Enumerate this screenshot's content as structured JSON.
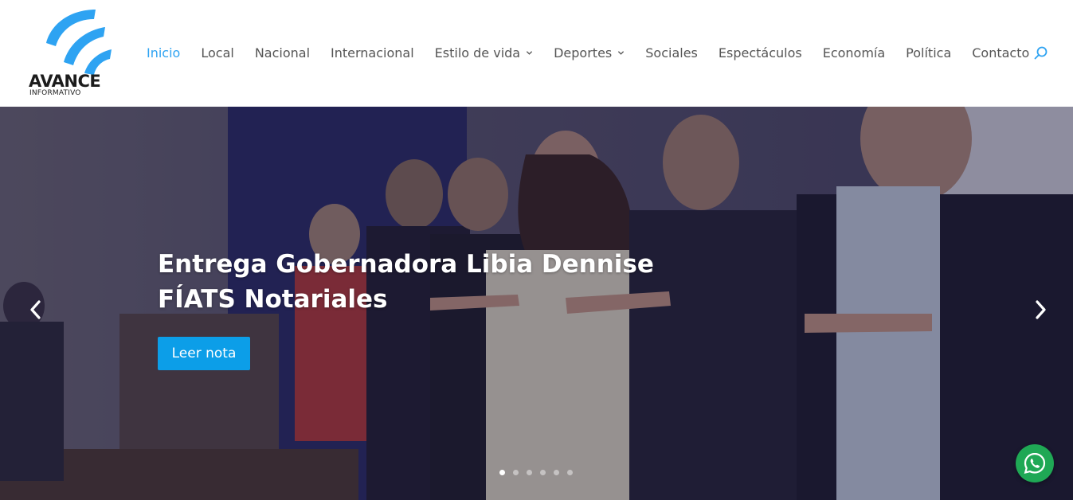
{
  "logo": {
    "title": "AVANCE",
    "subtitle": "INFORMATIVO"
  },
  "colors": {
    "accent": "#2ea3f2",
    "button": "#0c9ee8",
    "whatsapp": "#1fa855",
    "nav_text": "#555555"
  },
  "nav": {
    "items": [
      {
        "label": "Inicio",
        "active": true,
        "has_dropdown": false
      },
      {
        "label": "Local",
        "active": false,
        "has_dropdown": false
      },
      {
        "label": "Nacional",
        "active": false,
        "has_dropdown": false
      },
      {
        "label": "Internacional",
        "active": false,
        "has_dropdown": false
      },
      {
        "label": "Estilo de vida",
        "active": false,
        "has_dropdown": true
      },
      {
        "label": "Deportes",
        "active": false,
        "has_dropdown": true
      },
      {
        "label": "Sociales",
        "active": false,
        "has_dropdown": false
      },
      {
        "label": "Espectáculos",
        "active": false,
        "has_dropdown": false
      },
      {
        "label": "Economía",
        "active": false,
        "has_dropdown": false
      },
      {
        "label": "Política",
        "active": false,
        "has_dropdown": false
      },
      {
        "label": "Contacto",
        "active": false,
        "has_dropdown": false
      }
    ],
    "search_icon": "search-icon"
  },
  "slider": {
    "title": "Entrega Gobernadora Libia Dennise FÍATS Notariales",
    "button_label": "Leer nota",
    "slide_count": 6,
    "active_slide": 1,
    "prev_icon": "chevron-left-icon",
    "next_icon": "chevron-right-icon"
  },
  "whatsapp": {
    "icon": "whatsapp-icon"
  }
}
